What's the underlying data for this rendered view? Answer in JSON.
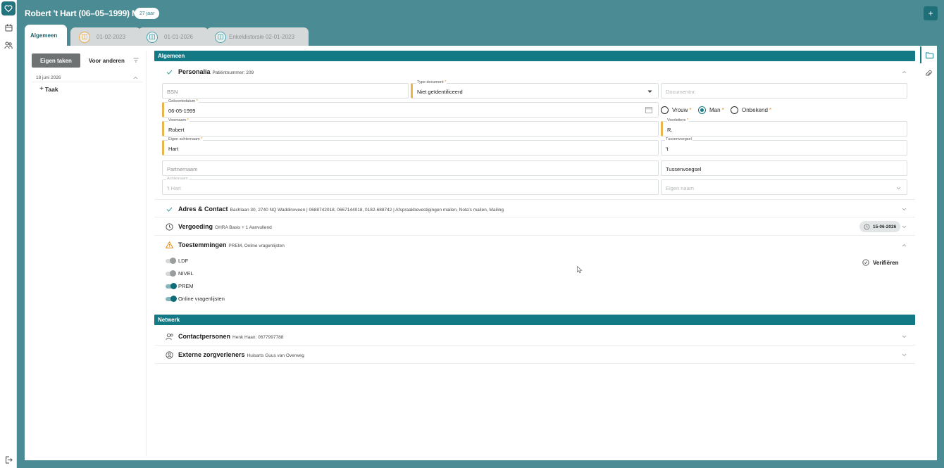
{
  "header": {
    "title": "Robert 't Hart (06–05–1999) M",
    "age_badge": "27 jaar",
    "add_label": "+"
  },
  "tabs": [
    {
      "label": "Algemeen",
      "active": true
    },
    {
      "label": "01-02-2023",
      "icon": "orange-journal-icon"
    },
    {
      "label": "01-01-2026",
      "icon": "teal-journal-icon"
    },
    {
      "label": "Enkeldistorsie  02-01-2023",
      "icon": "teal-journal-icon"
    }
  ],
  "tasks": {
    "tab_own": "Eigen taken",
    "tab_others": "Voor anderen",
    "date": "18 juni 2026",
    "add_label": "Taak"
  },
  "sections": {
    "algemeen": "Algemeen",
    "netwerk": "Netwerk"
  },
  "personalia": {
    "title": "Personalia",
    "meta": "Patiëntnummer: 209",
    "bsn_placeholder": "BSN",
    "type_document_label": "Type document",
    "type_document_value": "Niet geïdentificeerd",
    "documentnr_placeholder": "Documentnr.",
    "geboortedatum_label": "Geboortedatum",
    "geboortedatum_value": "06-05-1999",
    "gender_options": [
      "Vrouw",
      "Man",
      "Onbekend"
    ],
    "gender_selected": "Man",
    "voornaam_label": "Voornaam",
    "voornaam_value": "Robert",
    "voorletters_label": "Voorletters",
    "voorletters_value": "R.",
    "achternaam_label": "Eigen achternaam",
    "achternaam_value": "Hart",
    "tussenvoegsel_label": "Tussenvoegsel",
    "tussenvoegsel_value": "'t",
    "partnernaam_placeholder": "Partnernaam",
    "partner_tussenvoegsel_placeholder": "Tussenvoegsel",
    "aanschrijf_label": "Achternaam",
    "aanschrijf_value": "'t Hart",
    "eigen_naam_placeholder": "Eigen naam",
    "required_mark": "*"
  },
  "adres": {
    "title": "Adres & Contact",
    "meta": "Bachlaan 30, 2740 NQ Waddinxveen | 0688742018, 0667144018, 0182-688742 | Afspraakbevestigingen mailen, Nota's mailen, Mailing"
  },
  "vergoeding": {
    "title": "Vergoeding",
    "meta": "OHRA Basis + 1 Aanvullend",
    "date_pill": "15-06-2026"
  },
  "toestemmingen": {
    "title": "Toestemmingen",
    "meta": "PREM, Online vragenlijsten",
    "verify_label": "Verifiëren",
    "items": [
      {
        "label": "LDF",
        "on": false
      },
      {
        "label": "NIVEL",
        "on": false
      },
      {
        "label": "PREM",
        "on": true
      },
      {
        "label": "Online vragenlijsten",
        "on": true
      }
    ]
  },
  "contactpersonen": {
    "title": "Contactpersonen",
    "meta": "Henk Haan: 0677997788"
  },
  "zorgverleners": {
    "title": "Externe zorgverleners",
    "meta": "Huisarts Guus van Overweg"
  },
  "colors": {
    "teal": "#137985",
    "background": "#4b8b93",
    "required": "#e8b54d"
  }
}
